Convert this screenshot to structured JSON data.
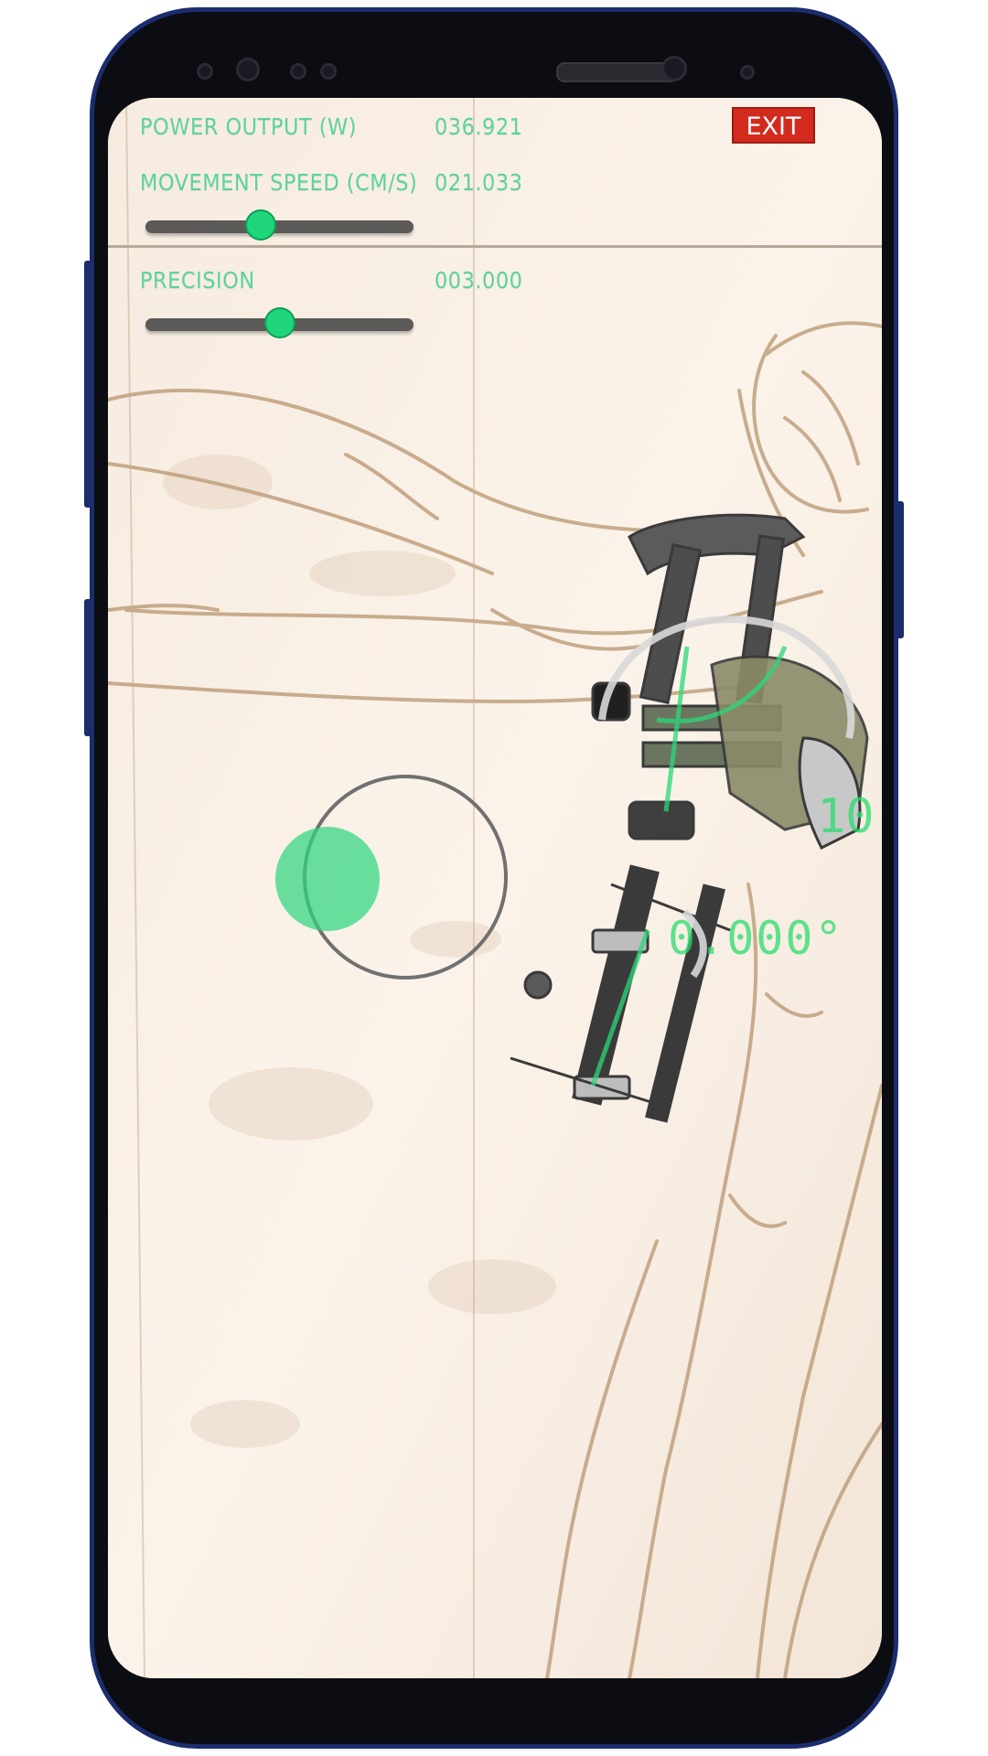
{
  "hud": {
    "power_label": "POWER OUTPUT (W)",
    "power_value": "036.921",
    "speed_label": "MOVEMENT SPEED (CM/S)",
    "speed_value": "021.033",
    "speed_slider_fraction": 0.43,
    "precision_label": "PRECISION",
    "precision_value": "003.000",
    "precision_slider_fraction": 0.5
  },
  "exit_label": "EXIT",
  "angle_readout": "0.000°",
  "angle_readout_partial": "10",
  "colors": {
    "hud_text": "#5bd49a",
    "slider_thumb": "#1fd67a",
    "exit_bg": "#d22a1c",
    "screen_bg": "#f4e8dc",
    "phone_frame": "#1c2d6e"
  },
  "icons": {
    "joystick": "virtual-joystick",
    "exoskeleton": "exoskeleton-arm-model"
  }
}
